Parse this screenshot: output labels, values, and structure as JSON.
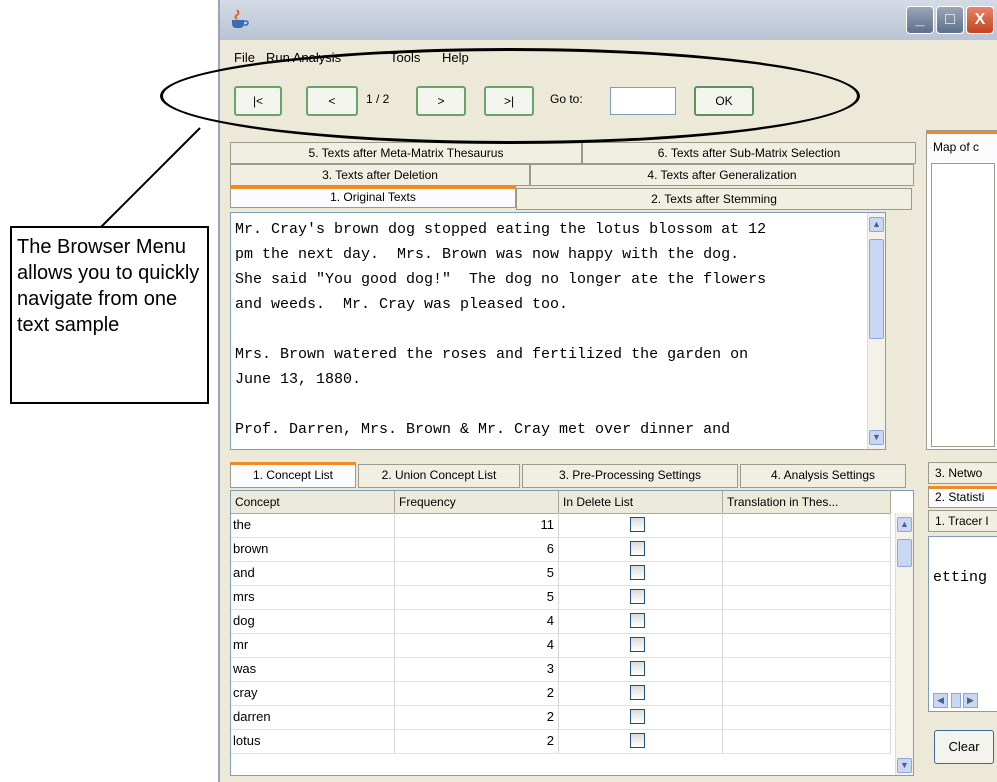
{
  "window": {
    "icon": "java-cup-icon",
    "controls": {
      "minimize": "_",
      "maximize": "□",
      "close": "X"
    }
  },
  "menu": [
    "File",
    "Run Analysis",
    "Tools",
    "Help"
  ],
  "navigator": {
    "first": "|<",
    "prev": "<",
    "page_indicator": "1 / 2",
    "next": ">",
    "last": ">|",
    "goto_label": "Go to:",
    "goto_value": "",
    "ok": "OK"
  },
  "text_tabs": {
    "row1": [
      "5. Texts after Meta-Matrix Thesaurus",
      "6. Texts after Sub-Matrix Selection"
    ],
    "row2": [
      "3. Texts after Deletion",
      "4. Texts after Generalization"
    ],
    "row3": [
      "1. Original Texts",
      "2. Texts after Stemming"
    ],
    "active": "1. Original Texts"
  },
  "original_text": "Mr. Cray's brown dog stopped eating the lotus blossom at 12\npm the next day.  Mrs. Brown was now happy with the dog.\nShe said \"You good dog!\"  The dog no longer ate the flowers\nand weeds.  Mr. Cray was pleased too.\n\nMrs. Brown watered the roses and fertilized the garden on\nJune 13, 1880.\n\nProf. Darren, Mrs. Brown & Mr. Cray met over dinner and",
  "right_pane": {
    "tab": "Map of c"
  },
  "bottom_tabs": [
    "1. Concept List",
    "2. Union Concept List",
    "3. Pre-Processing Settings",
    "4. Analysis Settings"
  ],
  "concept_table": {
    "columns": [
      "Concept",
      "Frequency",
      "In Delete List",
      "Translation in Thes..."
    ],
    "rows": [
      {
        "concept": "the",
        "frequency": "11"
      },
      {
        "concept": "brown",
        "frequency": "6"
      },
      {
        "concept": "and",
        "frequency": "5"
      },
      {
        "concept": "mrs",
        "frequency": "5"
      },
      {
        "concept": "dog",
        "frequency": "4"
      },
      {
        "concept": "mr",
        "frequency": "4"
      },
      {
        "concept": "was",
        "frequency": "3"
      },
      {
        "concept": "cray",
        "frequency": "2"
      },
      {
        "concept": "darren",
        "frequency": "2"
      },
      {
        "concept": "lotus",
        "frequency": "2"
      }
    ]
  },
  "right_bottom": {
    "tabs": [
      "3. Netwo",
      "2. Statisti",
      "1. Tracer l"
    ],
    "text": "etting",
    "clear": "Clear"
  },
  "annotation": {
    "callout": "The Browser Menu allows you to quickly navigate from one text sample"
  },
  "colors": {
    "tab_accent": "#f08a24",
    "nav_border": "#6aa36a"
  }
}
